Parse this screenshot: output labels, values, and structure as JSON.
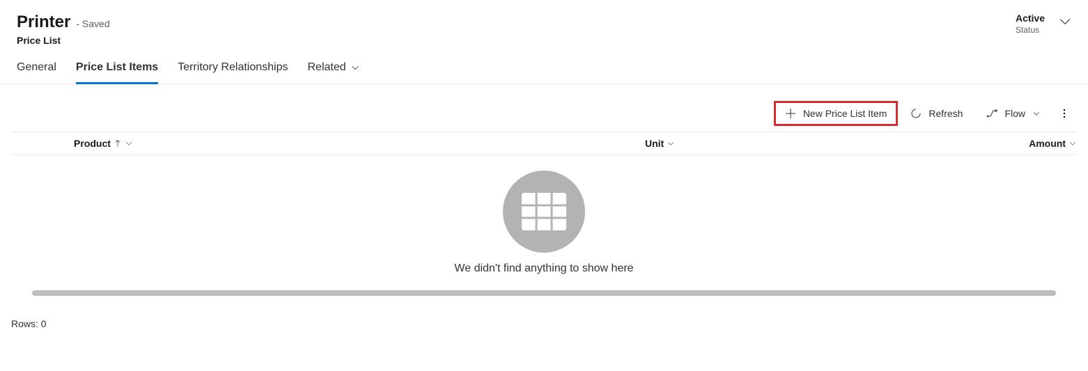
{
  "header": {
    "title": "Printer",
    "saved_status": "- Saved",
    "entity": "Price List",
    "status_value": "Active",
    "status_label": "Status"
  },
  "tabs": {
    "general": "General",
    "price_list_items": "Price List Items",
    "territory": "Territory Relationships",
    "related": "Related"
  },
  "toolbar": {
    "new_item": "New Price List Item",
    "refresh": "Refresh",
    "flow": "Flow"
  },
  "columns": {
    "product": "Product",
    "unit": "Unit",
    "amount": "Amount"
  },
  "empty": {
    "message": "We didn't find anything to show here"
  },
  "footer": {
    "rows_prefix": "Rows: ",
    "rows_count": "0"
  }
}
